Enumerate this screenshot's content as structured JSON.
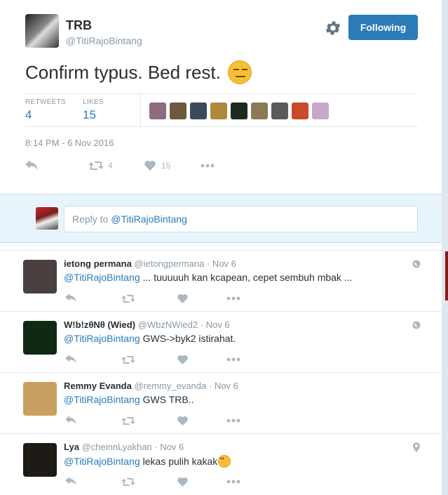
{
  "tweet": {
    "author_name": "TRB",
    "author_handle": "@TitiRajoBintang",
    "follow_label": "Following",
    "text": "Confirm typus. Bed rest.",
    "emoji": "expressionless-face",
    "retweets_label": "RETWEETS",
    "retweets_count": "4",
    "likes_label": "LIKES",
    "likes_count": "15",
    "likers": [
      "#8e6b7f",
      "#6b5a3c",
      "#3a4a5a",
      "#b0883a",
      "#1e2a1e",
      "#8a7a5a",
      "#5a5a5a",
      "#c94a2a",
      "#c8a8c8"
    ],
    "timestamp": "8:14 PM - 6 Nov 2016",
    "action_retweet_count": "4",
    "action_like_count": "15"
  },
  "reply_box": {
    "prefix": "Reply to ",
    "mention": "@TitiRajoBintang"
  },
  "replies": [
    {
      "name": "ietong permana",
      "handle": "@ietongpermana",
      "time": "· Nov 6",
      "mention": "@TitiRajoBintang",
      "text": "... tuuuuuh kan kcapean, cepet sembuh mbak  ...",
      "geo_icon": "globe-icon",
      "avatar_color": "#4a4040"
    },
    {
      "name": "W!b!zθNθ (Wied)",
      "handle": "@WbzNWied2",
      "time": "· Nov 6",
      "mention": "@TitiRajoBintang",
      "text": "GWS->byk2 istirahat.",
      "geo_icon": "globe-icon",
      "avatar_color": "#0f2a14"
    },
    {
      "name": "Remmy Evanda",
      "handle": "@remmy_evanda",
      "time": "· Nov 6",
      "mention": "@TitiRajoBintang",
      "text": "GWS TRB..",
      "geo_icon": "",
      "avatar_color": "#c8a060"
    },
    {
      "name": "Lya",
      "handle": "@cheinnLyakhan",
      "time": "· Nov 6",
      "mention": "@TitiRajoBintang",
      "text": "lekas pulih kakak",
      "geo_icon": "map-pin-icon",
      "avatar_color": "#1e1a16"
    }
  ]
}
